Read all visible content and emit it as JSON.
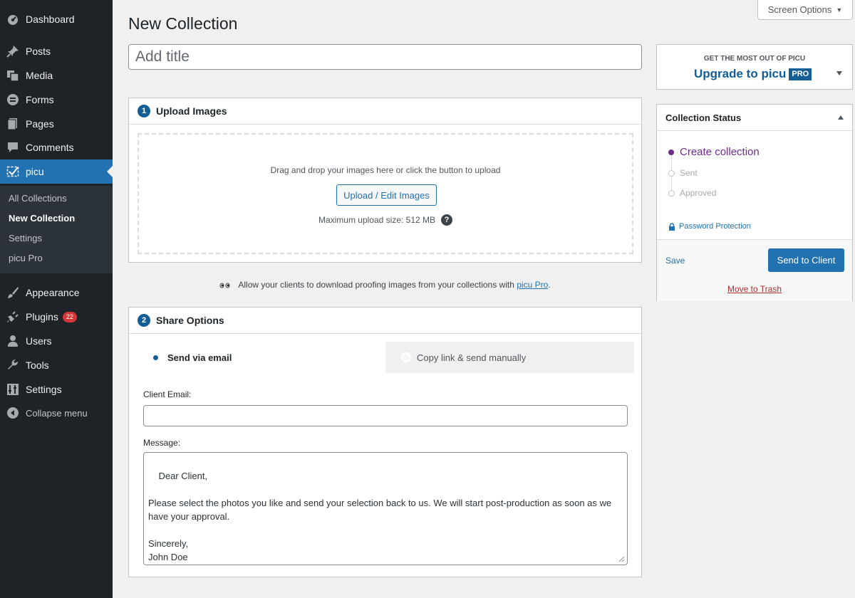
{
  "sidebar": {
    "items": [
      {
        "label": "Dashboard",
        "icon": "dashboard-icon"
      },
      {
        "label": "Posts",
        "icon": "pin-icon"
      },
      {
        "label": "Media",
        "icon": "media-icon"
      },
      {
        "label": "Forms",
        "icon": "forms-icon"
      },
      {
        "label": "Pages",
        "icon": "pages-icon"
      },
      {
        "label": "Comments",
        "icon": "comment-icon"
      },
      {
        "label": "picu",
        "icon": "picu-icon"
      },
      {
        "label": "Appearance",
        "icon": "brush-icon"
      },
      {
        "label": "Plugins",
        "icon": "plugin-icon",
        "badge": "22"
      },
      {
        "label": "Users",
        "icon": "users-icon"
      },
      {
        "label": "Tools",
        "icon": "wrench-icon"
      },
      {
        "label": "Settings",
        "icon": "settings-icon"
      },
      {
        "label": "Collapse menu",
        "icon": "collapse-icon"
      }
    ],
    "submenu": [
      "All Collections",
      "New Collection",
      "Settings",
      "picu Pro"
    ]
  },
  "screen_options": "Screen Options",
  "page_title": "New Collection",
  "title_placeholder": "Add title",
  "upload": {
    "step": "1",
    "heading": "Upload Images",
    "drop_text": "Drag and drop your images here or click the button to upload",
    "button": "Upload / Edit Images",
    "max_size": "Maximum upload size: 512 MB",
    "help": "?"
  },
  "promo": {
    "text": "Allow your clients to download proofing images from your collections with ",
    "link": "picu Pro",
    "end": "."
  },
  "share": {
    "step": "2",
    "heading": "Share Options",
    "tab_email": "Send via email",
    "tab_link": "Copy link & send manually",
    "email_label": "Client Email:",
    "email_value": "",
    "message_label": "Message:",
    "message": "Dear Client,\n\nPlease select the photos you like and send your selection back to us. We will start post-production as soon as we have your approval.\n\nSincerely,\nJohn Doe"
  },
  "upgrade": {
    "subtitle": "GET THE MOST OUT OF PICU",
    "title": "Upgrade to picu",
    "badge": "PRO"
  },
  "status": {
    "heading": "Collection Status",
    "steps": [
      "Create collection",
      "Sent",
      "Approved"
    ],
    "current_step": 0,
    "password": "Password Protection",
    "save": "Save",
    "send": "Send to Client",
    "trash": "Move to Trash"
  },
  "colors": {
    "accent": "#2271b1",
    "sidebar": "#1d2327",
    "status_current": "#6f2b8a",
    "badge": "#d63638"
  }
}
